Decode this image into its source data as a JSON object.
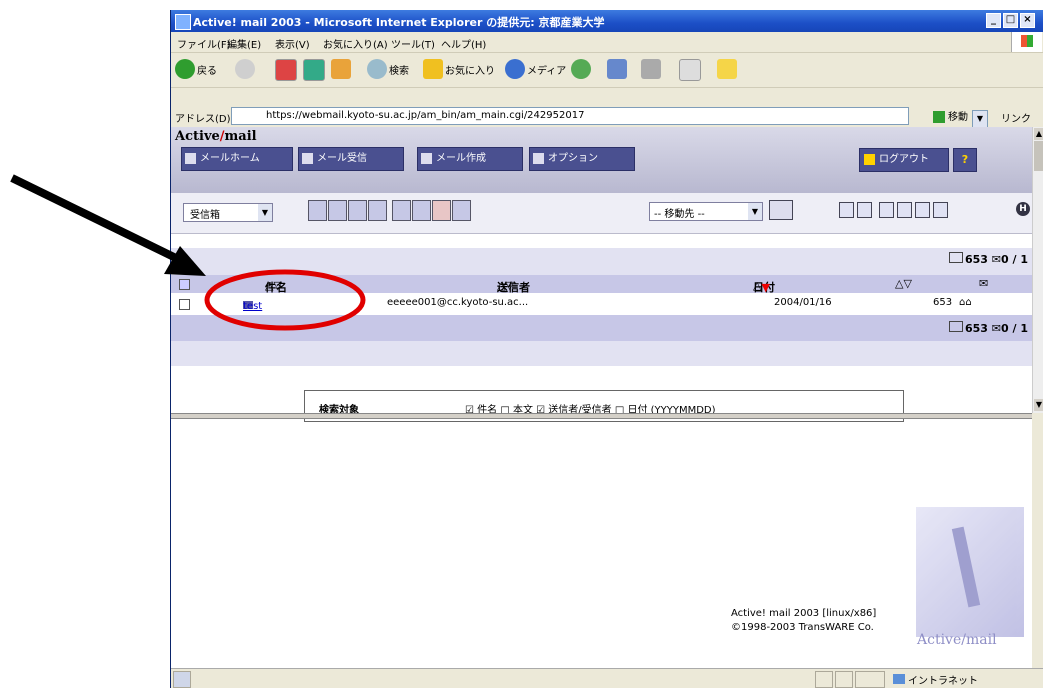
{
  "window": {
    "title": "Active! mail 2003 - Microsoft Internet Explorer の提供元: 京都産業大学",
    "controls": [
      "_",
      "□",
      "×"
    ]
  },
  "menu": [
    "ファイル(F)",
    "編集(E)",
    "表示(V)",
    "お気に入り(A)",
    "ツール(T)",
    "ヘルプ(H)"
  ],
  "toolbar": {
    "back": "戻る",
    "search": "検索",
    "favorites": "お気に入り",
    "media": "メディア"
  },
  "address": {
    "label": "アドレス(D)",
    "url": "https://webmail.kyoto-su.ac.jp/am_bin/am_main.cgi/242952017",
    "go": "移動",
    "links": "リンク"
  },
  "app": {
    "logo_a": "Active",
    "logo_b": "mail",
    "nav": [
      "メールホーム",
      "メール受信",
      "メール作成",
      "オプション"
    ],
    "logout": "ログアウト",
    "help": "?",
    "folder_select": "受信箱",
    "move_select": "-- 移動先 --",
    "h_label": "H"
  },
  "mail_list": {
    "count_top": "653 ✉0 / 1",
    "count_bottom": "653 ✉0 / 1",
    "headers": {
      "subject": "件名",
      "sender": "送信者",
      "date": "日付",
      "size_icon": "✉"
    },
    "rows": [
      {
        "subject": "test",
        "sender": "eeeee001@cc.kyoto-su.ac...",
        "date": "2004/01/16",
        "size": "653"
      }
    ]
  },
  "search": {
    "label": "検索対象",
    "options": "☑ 件名 □ 本文 ☑ 送信者/受信者 □ 日付 (YYYYMMDD)"
  },
  "footer": {
    "version": "Active! mail 2003 [linux/x86]",
    "copyright": "©1998-2003 TransWARE Co.",
    "logo_text": "Active/mail"
  },
  "statusbar": {
    "zone": "イントラネット"
  },
  "colors": {
    "titlebar": "#1c4fc7",
    "nav_button": "#4a5090",
    "annotation_red": "#e00000",
    "arrow": "#000000"
  }
}
